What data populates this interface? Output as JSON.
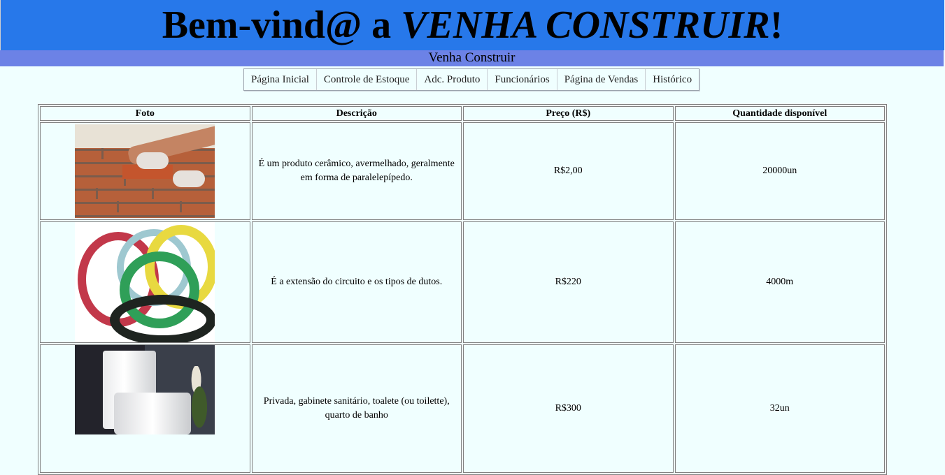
{
  "header": {
    "title_prefix": "Bem-vind@ a ",
    "title_brand": "VENHA CONSTRUIR",
    "title_suffix": "!",
    "subtitle": "Venha Construir"
  },
  "nav": {
    "items": [
      {
        "label": "Página Inicial"
      },
      {
        "label": "Controle de Estoque"
      },
      {
        "label": "Adc. Produto"
      },
      {
        "label": "Funcionários"
      },
      {
        "label": "Página de Vendas"
      },
      {
        "label": "Histórico"
      }
    ]
  },
  "table": {
    "headers": [
      "Foto",
      "Descrição",
      "Preço (R$)",
      "Quantidade disponível"
    ],
    "rows": [
      {
        "photo": "bricks-photo",
        "description": "É um produto cerâmico, avermelhado, geralmente em forma de paralelepípedo.",
        "price": "R$2,00",
        "quantity": "20000un"
      },
      {
        "photo": "wire-coils-photo",
        "description": "É a extensão do circuito e os tipos de dutos.",
        "price": "R$220",
        "quantity": "4000m"
      },
      {
        "photo": "toilet-photo",
        "description": "Privada, gabinete sanitário, toalete (ou toilette), quarto de banho",
        "price": "R$300",
        "quantity": "32un"
      }
    ]
  },
  "colors": {
    "banner": "#2778ea",
    "subbar": "#6c82e6",
    "page_background": "#f0ffff"
  }
}
